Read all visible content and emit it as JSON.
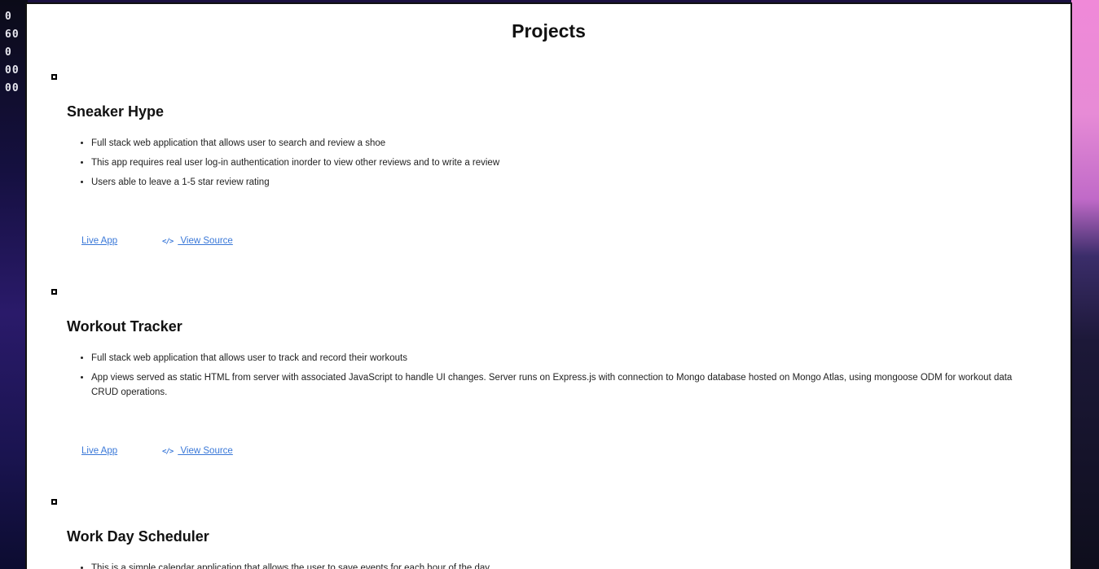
{
  "page": {
    "title": "Projects"
  },
  "background": {
    "left_digits": "0\n60\n0\n00\n00"
  },
  "projects": [
    {
      "title": "Sneaker Hype",
      "features": [
        "Full stack web application that allows user to search and review a shoe",
        "This app requires real user log-in authentication inorder to view other reviews and to write a review",
        "Users able to leave a 1-5 star review rating"
      ],
      "live_label": "Live App",
      "source_label": " View Source",
      "source_icon": "code-icon"
    },
    {
      "title": "Workout Tracker",
      "features": [
        "Full stack web application that allows user to track and record their workouts",
        "App views served as static HTML from server with associated JavaScript to handle UI changes. Server runs on Express.js with connection to Mongo database hosted on Mongo Atlas, using mongoose ODM for workout data CRUD operations."
      ],
      "live_label": "Live App",
      "source_label": " View Source",
      "source_icon": "code-icon"
    },
    {
      "title": "Work Day Scheduler",
      "features": [
        "This is a simple calendar application that allows the user to save events for each hour of the day"
      ]
    }
  ],
  "colors": {
    "link": "#3a78d8",
    "page_bg": "#ffffff"
  }
}
